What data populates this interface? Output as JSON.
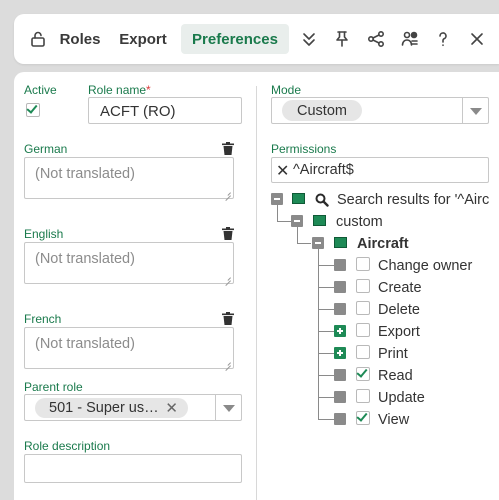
{
  "toolbar": {
    "roles_label": "Roles",
    "export_label": "Export",
    "preferences_label": "Preferences"
  },
  "form": {
    "active_label": "Active",
    "active_checked": true,
    "role_name_label": "Role name",
    "role_name_required_mark": "*",
    "role_name_value": "ACFT (RO)",
    "german_label": "German",
    "german_placeholder": "(Not translated)",
    "english_label": "English",
    "english_placeholder": "(Not translated)",
    "french_label": "French",
    "french_placeholder": "(Not translated)",
    "parent_role_label": "Parent role",
    "parent_role_value": "501 - Super us…",
    "role_description_label": "Role description",
    "role_description_value": ""
  },
  "right": {
    "mode_label": "Mode",
    "mode_value": "Custom",
    "permissions_label": "Permissions",
    "permissions_filter": "^Aircraft$",
    "tree": {
      "root_label": "Search results for '^Airc",
      "custom_label": "custom",
      "aircraft_label": "Aircraft",
      "items": [
        {
          "label": "Change owner",
          "checked": false,
          "toggle": "grey"
        },
        {
          "label": "Create",
          "checked": false,
          "toggle": "grey"
        },
        {
          "label": "Delete",
          "checked": false,
          "toggle": "grey"
        },
        {
          "label": "Export",
          "checked": false,
          "toggle": "plus"
        },
        {
          "label": "Print",
          "checked": false,
          "toggle": "plus"
        },
        {
          "label": "Read",
          "checked": true,
          "toggle": "grey"
        },
        {
          "label": "Update",
          "checked": false,
          "toggle": "grey"
        },
        {
          "label": "View",
          "checked": true,
          "toggle": "grey"
        }
      ]
    }
  },
  "colors": {
    "accent": "#1a7a4c",
    "accent_bg": "#e9eeec",
    "required": "#d93a3a",
    "background": "#dcdcdc"
  },
  "icons": [
    "lock-icon",
    "chevrons-down-icon",
    "pin-icon",
    "share-icon",
    "users-settings-icon",
    "help-icon",
    "close-icon",
    "trash-icon",
    "search-icon",
    "chevron-down-icon",
    "clear-icon"
  ]
}
